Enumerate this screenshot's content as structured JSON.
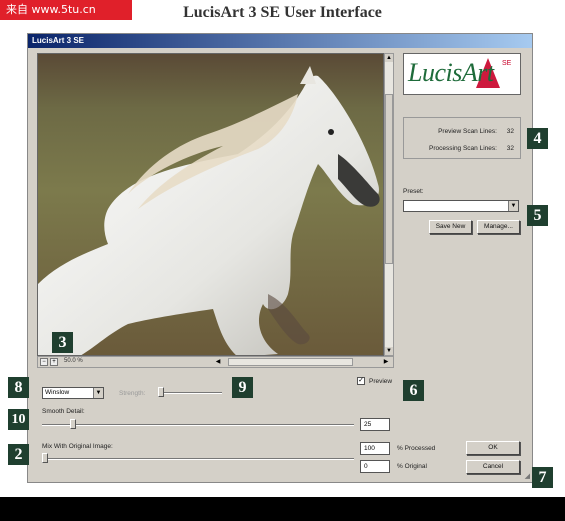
{
  "watermark": "来自 www.5tu.cn",
  "caption": "LucisArt 3 SE User Interface",
  "window": {
    "title": "LucisArt 3 SE",
    "zoom": "50.0 %",
    "logo": {
      "text": "LucisArt",
      "version": "SE"
    },
    "scan": {
      "preview_label": "Preview Scan Lines:",
      "preview_value": "32",
      "processing_label": "Processing Scan Lines:",
      "processing_value": "32"
    },
    "preset": {
      "label": "Preset:",
      "value": ""
    },
    "save_new": "Save New",
    "manage": "Manage...",
    "preview_label": "Preview",
    "preview_checked": true,
    "mode": {
      "value": "Winslow"
    },
    "strength_label": "Strength:",
    "smooth_detail": {
      "label": "Smooth Detail:",
      "value": "25"
    },
    "mix": {
      "label": "Mix With Original Image:",
      "processed": "100",
      "processed_label": "% Processed",
      "original": "0",
      "original_label": "% Original"
    },
    "ok": "OK",
    "cancel": "Cancel"
  },
  "badges": [
    "3",
    "4",
    "5",
    "6",
    "8",
    "9",
    "10",
    "2",
    "7"
  ],
  "colors": {
    "badge": "#1f3f2f",
    "logo_green": "#1e6b3a",
    "logo_red": "#c80028",
    "dialog": "#d4d0c8"
  }
}
